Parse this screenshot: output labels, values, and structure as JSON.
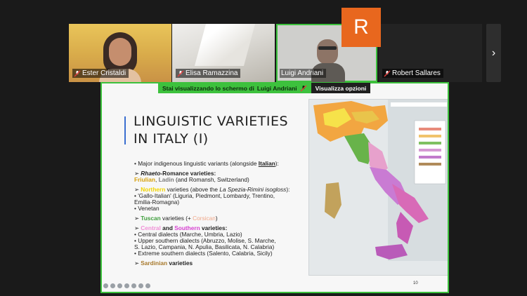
{
  "participants": [
    {
      "name": "Ester Cristaldi",
      "muted": true
    },
    {
      "name": "Elisa Ramazzina",
      "muted": true
    },
    {
      "name": "Luigi Andriani",
      "muted": false
    },
    {
      "name": "Robert Sallares",
      "muted": true,
      "avatar_letter": "R",
      "avatar_color": "#e8671e"
    }
  ],
  "share_banner": {
    "text": "Stai visualizzando lo schermo di",
    "user": "Luigi Andriani",
    "options_label": "Visualizza opzioni"
  },
  "slide": {
    "title_line1": "LINGUISTIC VARIETIES",
    "title_line2": "IN ITALY (I)",
    "page_number": "10",
    "l1_pre": "• Major indigenous linguistic variants (alongside ",
    "l1_italian": "Italian",
    "l1_post": "):",
    "rhaeto_arrow": "➢ ",
    "rhaeto_it": "Rhaeto",
    "rhaeto_rest": "-Romance varieties:",
    "friulian": "Friulian",
    "comma": ", ",
    "ladin": "Ladin",
    "friul_rest": " (and Romansh, Switzerland)",
    "north_arrow": "➢ ",
    "northern": "Northern",
    "north_rest1": " varieties (above the ",
    "north_line": "La Spezia-Rimini isogloss",
    "north_rest2": "):",
    "gallo": "• 'Gallo-Italian' (Liguria, Piedmont, Lombardy, Trentino,",
    "gallo2": "  Emilia-Romagna)",
    "venetan": "• Venetan",
    "tusc_arrow": "➢ ",
    "tuscan": "Tuscan",
    "tusc_rest": " varieties (+ ",
    "corsican": "Corsican",
    "close": ")",
    "cs_arrow": "➢ ",
    "central": "Central",
    "and": " and ",
    "southern": "Southern",
    "cs_rest": " varieties:",
    "central_d": "• Central dialects (Marche, Umbria, Lazio)",
    "upper1": "• Upper southern dialects (Abruzzo, Molise, S. Marche,",
    "upper2": "S. Lazio, Campania, N. Apulia, Basilicata, N. Calabria)",
    "extreme": "• Extreme southern dialects (Salento, Calabria, Sicily)",
    "sard_arrow": "➢ ",
    "sardinian": "Sardinian",
    "sard_rest": " varieties"
  }
}
